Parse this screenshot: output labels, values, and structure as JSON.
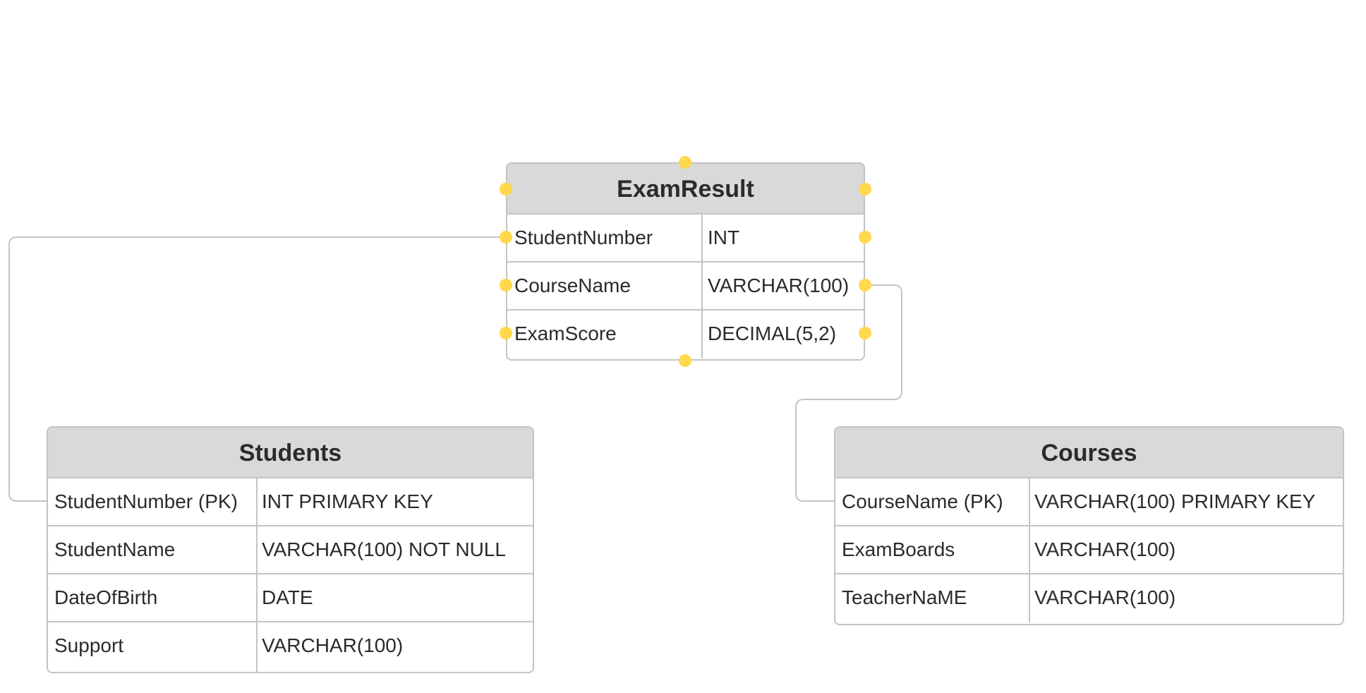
{
  "tables": {
    "exam_result": {
      "title": "ExamResult",
      "rows": [
        {
          "name": "StudentNumber",
          "type": "INT"
        },
        {
          "name": "CourseName",
          "type": "VARCHAR(100)"
        },
        {
          "name": "ExamScore",
          "type": "DECIMAL(5,2)"
        }
      ]
    },
    "students": {
      "title": "Students",
      "rows": [
        {
          "name": "StudentNumber (PK)",
          "type": "INT PRIMARY KEY"
        },
        {
          "name": "StudentName",
          "type": "VARCHAR(100) NOT NULL"
        },
        {
          "name": "DateOfBirth",
          "type": "DATE"
        },
        {
          "name": "Support",
          "type": "VARCHAR(100)"
        }
      ]
    },
    "courses": {
      "title": "Courses",
      "rows": [
        {
          "name": "CourseName (PK)",
          "type": "VARCHAR(100) PRIMARY KEY"
        },
        {
          "name": "ExamBoards",
          "type": "VARCHAR(100)"
        },
        {
          "name": "TeacherNaME",
          "type": "VARCHAR(100)"
        }
      ]
    }
  },
  "colors": {
    "handle": "#ffd84d",
    "header_bg": "#d9d9d9",
    "border": "#c4c4c4",
    "connector": "#c4c4c4"
  }
}
